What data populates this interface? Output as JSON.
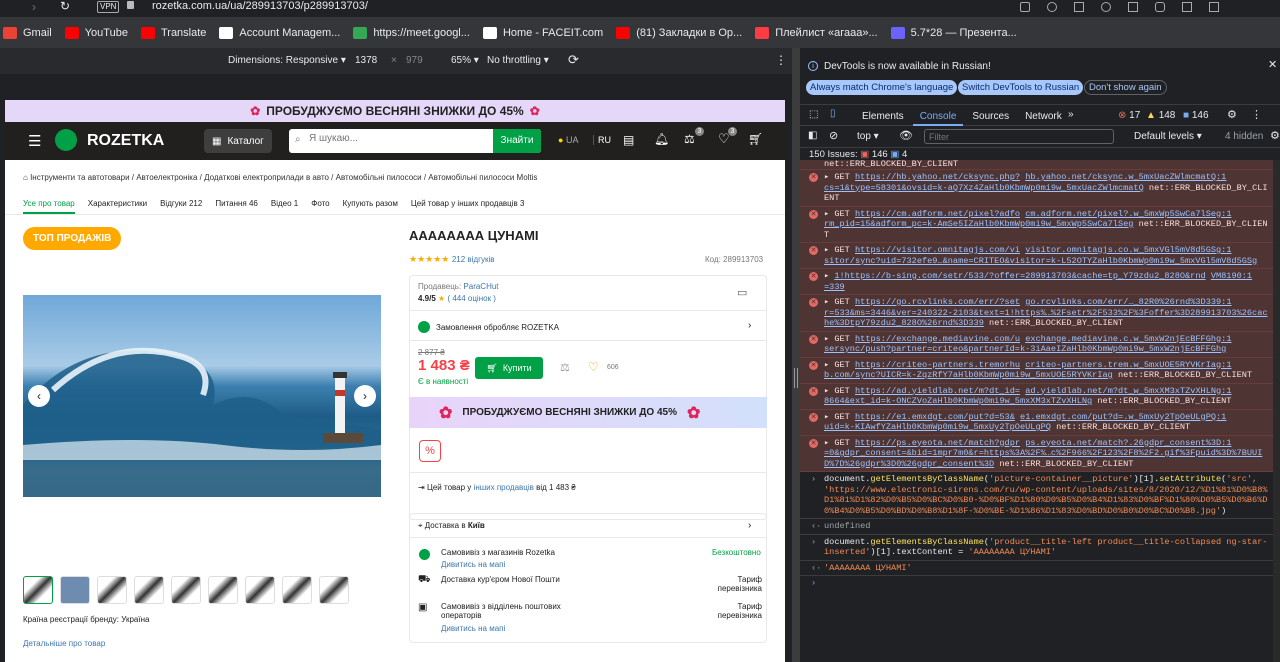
{
  "browser": {
    "vpn": "VPN",
    "url": "rozetka.com.ua/ua/289913703/p289913703/",
    "bookmarks": [
      {
        "label": "Gmail",
        "color": "#ea4335"
      },
      {
        "label": "YouTube",
        "color": "#ff0000"
      },
      {
        "label": "Translate",
        "color": "#ff0000"
      },
      {
        "label": "Account Managem...",
        "color": "#ffffff"
      },
      {
        "label": "https://meet.googl...",
        "color": "#34a853"
      },
      {
        "label": "Home - FACEIT.com",
        "color": "#ffffff"
      },
      {
        "label": "(81) Закладки в Ор...",
        "color": "#ff0000"
      },
      {
        "label": "Плейлист «агааа»...",
        "color": "#fc3c44"
      },
      {
        "label": "5.7*28 — Презента...",
        "color": "#6c63ff"
      }
    ]
  },
  "device_toolbar": {
    "dimensions": "Dimensions: Responsive",
    "width": "1378",
    "times": "×",
    "height": "979",
    "zoom": "65%",
    "throttling": "No throttling"
  },
  "rozetka": {
    "promo": "ПРОБУДЖУЄМО ВЕСНЯНІ ЗНИЖКИ ДО 45%",
    "logo": "ROZETKA",
    "catalog": "Каталог",
    "search_placeholder": "Я шукаю...",
    "search_btn": "Знайти",
    "lang_ua": "UA",
    "lang_ru": "RU",
    "badge_compare": "3",
    "badge_wish": "3",
    "breadcrumbs": "Інструменти та автотовари / Автоелектроніка / Додаткові електроприлади в авто / Автомобільні пилососи / Автомобільні пилососи Moltis",
    "tabs": [
      "Усе про товар",
      "Характеристики",
      "Відгуки 212",
      "Питання 46",
      "Відео 1",
      "Фото",
      "Купують разом",
      "Цей товар у інших продавців 3"
    ],
    "top_badge": "ТОП ПРОДАЖІВ",
    "title": "АААААААА ЦУНАМІ",
    "reviews": "212 відгуків",
    "code": "Код: 289913703",
    "seller_label": "Продавець:",
    "seller": "ParaCHut",
    "seller_rating": "4.9/5",
    "seller_reviews": "( 444 оцінок )",
    "order_handled": "Замовлення обробляє ROZETKA",
    "old_price": "2 877 ₴",
    "price": "1 483 ₴",
    "availability": "Є в наявності",
    "buy": "Купити",
    "wish_count": "606",
    "banner": "ПРОБУДЖУЄМО ВЕСНЯНІ ЗНИЖКИ ДО 45%",
    "other_sellers_pre": "Цей товар у",
    "other_sellers_link": "інших продавців",
    "other_sellers_post": "від 1 483 ₴",
    "delivery_title_pre": "Доставка в",
    "delivery_city": "Київ",
    "pickup_rozetka": "Самовивіз з магазинів Rozetka",
    "pickup_rozetka_price": "Безкоштовно",
    "look_map": "Дивитись на мапі",
    "courier": "Доставка кур'єром Нової Пошти",
    "tariff": "Тариф перевізника",
    "post_pickup": "Самовивіз з відділень поштових операторів",
    "look_map2": "Дивитись на мапі",
    "tariff2": "Тариф перевізника",
    "origin": "Країна реєстрації бренду: Україна",
    "details": "Детальніше про товар"
  },
  "devtools": {
    "infobar": "DevTools is now available in Russian!",
    "btn_match": "Always match Chrome's language",
    "btn_switch": "Switch DevTools to Russian",
    "btn_dont": "Don't show again",
    "tabs": [
      "Elements",
      "Console",
      "Sources",
      "Network"
    ],
    "err_count": "17",
    "warn_count": "148",
    "info_count": "146",
    "context": "top",
    "filter_placeholder": "Filter",
    "levels": "Default levels",
    "hidden": "4 hidden",
    "issues": "150 Issues:",
    "issues_a": "146",
    "issues_b": "4",
    "cut_line": "net::ERR_BLOCKED_BY_CLIENT",
    "errors": [
      {
        "m": "GET",
        "u": "https://hb.yahoo.net/cksync.php?",
        "r": "hb.yahoo.net/cksync.w_5mxUacZWlmcmatQ:1",
        "b": "cs=1&type=58301&ovsid=k-aQ7Xz4ZaHlb0KbmWp0mi9w_5mxUacZWlmcmatQ",
        "t": "net::ERR_BLOCKED_BY_CLIENT"
      },
      {
        "m": "GET",
        "u": "https://cm.adform.net/pixel?adfo",
        "r": "cm.adform.net/pixel?.w_5mxWp5SwCa7lSeg:1",
        "b": "rm_pid=15&adform_pc=k-AmSe5IZaHlb0KbmWp0mi9w_5mxWp5SwCa7lSeg",
        "t": "net::ERR_BLOCKED_BY_CLIENT"
      },
      {
        "m": "GET",
        "u": "https://visitor.omnitagjs.com/vi",
        "r": "visitor.omnitagjs.co.w_5mxVGl5mV8d5GSg:1",
        "b": "sitor/sync?uid=732efe9…&name=CRITEO&visitor=k-L52OTYZaHlb0KbmWp0mi9w_5mxVGl5mV8d5GSg",
        "t": ""
      },
      {
        "m": "",
        "u": "1!https://b-sing.com/setr/533/?offer=289913703&cache=tp_Y79zdu2_828O&rnd",
        "r": "VM8190:1",
        "b": "=339",
        "t": ""
      },
      {
        "m": "GET",
        "u": "https://go.rcvlinks.com/err/?set",
        "r": "go.rcvlinks.com/err/…_82R0%26rnd%3D339:1",
        "b": "r=533&ms=3446&ver=240322-2103&text=1!https%…%2Fsetr%2F533%2F%3Foffer%3D289913703%26cache%3DtpY79zdu2_828O%26rnd%3D339",
        "t": "net::ERR_BLOCKED_BY_CLIENT"
      },
      {
        "m": "GET",
        "u": "https://exchange.mediavine.com/u",
        "r": "exchange.mediavine.c.w_5mxW2njEcBFFGhg:1",
        "b": "sersync/push?partner=criteo&partnerId=k-3iAaeIZaHlb0KbmWp0mi9w_5mxW2njEcBFFGhg",
        "t": ""
      },
      {
        "m": "GET",
        "u": "https://criteo-partners.tremorhu",
        "r": "criteo-partners.trem.w_5mxUOE5RYVKrIag:1",
        "b": "b.com/sync?UICR=k-ZqzRfY7aHlb0KbmWp0mi9w_5mxUOE5RYVKrIag",
        "t": "net::ERR_BLOCKED_BY_CLIENT"
      },
      {
        "m": "GET",
        "u": "https://ad.yieldlab.net/m?dt_id=",
        "r": "ad.yieldlab.net/m?dt_w_5mxXM3xTZvXHLNg:1",
        "b": "8664&ext_id=k-ONCZVoZaHlb0KbmWp0mi9w_5mxXM3xTZvXHLNg",
        "t": "net::ERR_BLOCKED_BY_CLIENT"
      },
      {
        "m": "GET",
        "u": "https://e1.emxdgt.com/put?d=53&",
        "r": "e1.emxdgt.com/put?d=.w_5mxUy2TpOeULgPQ:1",
        "b": "uid=k-KIAwfYZaHlb0KbmWp0mi9w_5mxUy2TpOeULgPQ",
        "t": "net::ERR_BLOCKED_BY_CLIENT"
      },
      {
        "m": "GET",
        "u": "https://ps.eyeota.net/match?gdpr",
        "r": "ps.eyeota.net/match?.26gdpr_consent%3D:1",
        "b": "=0&gdpr_consent=&bid=1mpr7m0&r=https%3A%2F%…c%2F966%2F123%2F8%2F2.gif%3Fpuid%3D%7BUUID%7D%26gdpr%3D0%26gdpr_consent%3D",
        "t": "net::ERR_BLOCKED_BY_CLIENT"
      }
    ],
    "cmd1_pre": "document.",
    "cmd1_fn": "getElementsByClassName",
    "cmd1_arg": "'picture-container__picture'",
    "cmd1_mid": ")[1].",
    "cmd1_fn2": "setAttribute",
    "cmd1_arg2": "'src', 'https://www.electronic-sirens.com/ru/wp-content/uploads/sites/8/2020/12/%D1%81%D0%B8%D1%81%D1%82%D0%B5%D0%BC%D0%B0-%D0%BF%D1%80%D0%B5%D0%B4%D1%83%D0%BF%D1%80%D0%B5%D0%B6%D0%B4%D0%B5%D0%BD%D0%B8%D1%8F-%D0%BE-%D1%86%D1%83%D0%BD%D0%B0%D0%BC%D0%B8.jpg'",
    "res1": "undefined",
    "cmd2_pre": "document.",
    "cmd2_fn": "getElementsByClassName",
    "cmd2_arg": "'product__title-left product__title-collapsed ng-star-inserted'",
    "cmd2_post": ")[1].textContent = ",
    "cmd2_val": "'АААААААА ЦУНАМІ'",
    "res2": "'АААААААА ЦУНАМІ'"
  }
}
